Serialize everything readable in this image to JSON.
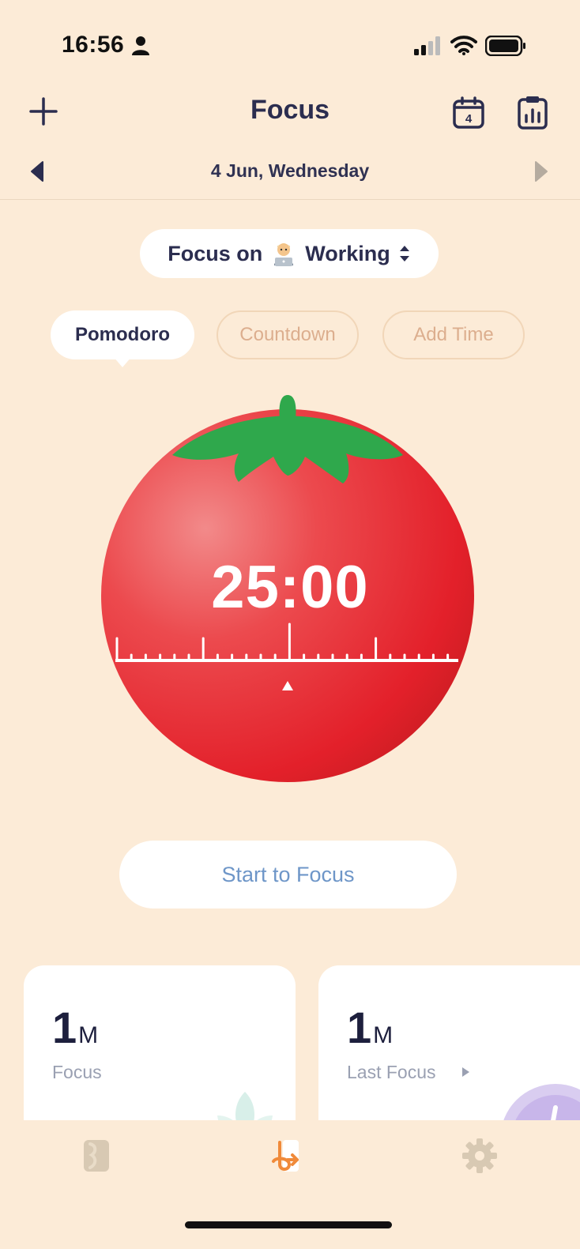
{
  "status_bar": {
    "time": "16:56",
    "icons": [
      "person-icon",
      "signal-icon",
      "wifi-icon",
      "battery-icon"
    ]
  },
  "nav": {
    "title": "Focus",
    "calendar_day": "4",
    "icons": [
      "plus-icon",
      "calendar-icon",
      "stats-clipboard-icon"
    ]
  },
  "date_bar": {
    "label": "4 Jun, Wednesday"
  },
  "focus_selector": {
    "prefix": "Focus on",
    "task": "Working",
    "emoji_icon": "technologist-emoji-icon"
  },
  "modes": {
    "tabs": [
      {
        "label": "Pomodoro",
        "active": true
      },
      {
        "label": "Countdown",
        "active": false
      },
      {
        "label": "Add Time",
        "active": false
      }
    ]
  },
  "timer": {
    "display": "25:00"
  },
  "start_button": {
    "label": "Start to Focus"
  },
  "cards": [
    {
      "value": "1",
      "unit": "M",
      "label": "Focus"
    },
    {
      "value": "1",
      "unit": "M",
      "label": "Last Focus"
    }
  ],
  "tab_bar": {
    "items": [
      "journal-icon",
      "focus-timer-icon",
      "settings-gear-icon"
    ]
  },
  "colors": {
    "background": "#fcebd7",
    "tomato_red": "#e8262e",
    "leaf_green": "#2fa84c",
    "text_dark": "#2b2d4f",
    "start_text": "#6e96c8",
    "inactive_tab_text": "#dcae8e"
  }
}
